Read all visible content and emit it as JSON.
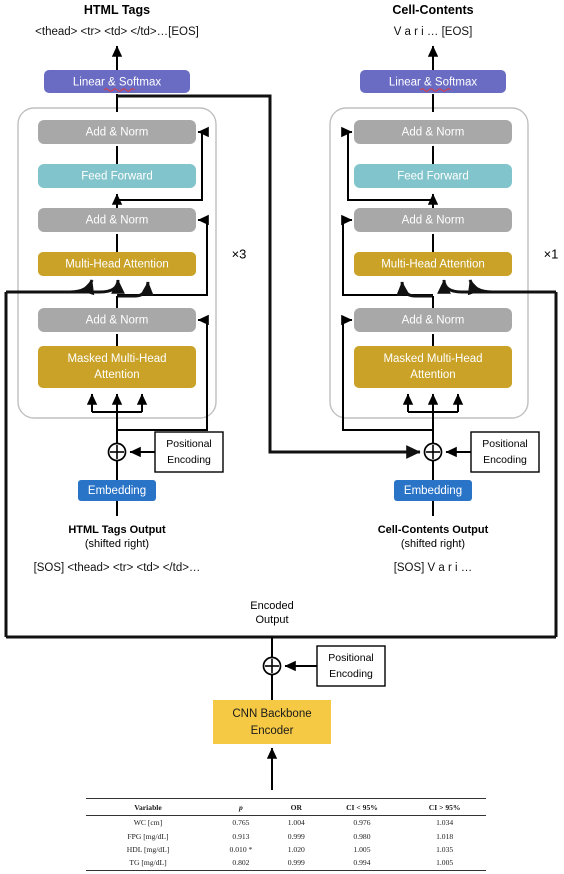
{
  "diagram": {
    "title": "Dual-decoder Transformer for table recognition",
    "colors": {
      "linear_softmax": "#6a6cc4",
      "add_norm": "#a8a8a8",
      "feed_forward": "#82c4cb",
      "attention": "#c9a227",
      "embedding": "#2a74c8",
      "cnn_backbone": "#f6c944",
      "panel_border": "#bfbfbf",
      "line": "#000000"
    },
    "branches": [
      {
        "id": "html-tags",
        "header_title": "HTML Tags",
        "header_sequence": "<thead> <tr> <td> </td>…[EOS]",
        "repeat_label": "×3",
        "footer_title": "HTML Tags Output",
        "footer_subtitle": "(shifted right)",
        "footer_sequence": "[SOS] <thead> <tr> <td> </td>…",
        "blocks": {
          "linear_softmax": "Linear & Softmax",
          "add_norm_top": "Add & Norm",
          "feed_forward": "Feed Forward",
          "add_norm_mid": "Add & Norm",
          "multi_head_attention": "Multi-Head Attention",
          "add_norm_bottom": "Add & Norm",
          "masked_attention_line1": "Masked Multi-Head",
          "masked_attention_line2": "Attention",
          "embedding": "Embedding",
          "positional_encoding_line1": "Positional",
          "positional_encoding_line2": "Encoding"
        }
      },
      {
        "id": "cell-contents",
        "header_title": "Cell-Contents",
        "header_sequence": "V a r i   … [EOS]",
        "repeat_label": "×1",
        "footer_title": "Cell-Contents Output",
        "footer_subtitle": "(shifted right)",
        "footer_sequence": "[SOS] V a r i   …",
        "blocks": {
          "linear_softmax": "Linear & Softmax",
          "add_norm_top": "Add & Norm",
          "feed_forward": "Feed Forward",
          "add_norm_mid": "Add & Norm",
          "multi_head_attention": "Multi-Head Attention",
          "add_norm_bottom": "Add & Norm",
          "masked_attention_line1": "Masked Multi-Head",
          "masked_attention_line2": "Attention",
          "embedding": "Embedding",
          "positional_encoding_line1": "Positional",
          "positional_encoding_line2": "Encoding"
        }
      }
    ],
    "encoder": {
      "bus_label_line1": "Encoded",
      "bus_label_line2": "Output",
      "positional_encoding_line1": "Positional",
      "positional_encoding_line2": "Encoding",
      "backbone_line1": "CNN Backbone",
      "backbone_line2": "Encoder"
    }
  },
  "results_table": {
    "columns": [
      "Variable",
      "p",
      "OR",
      "CI < 95%",
      "CI > 95%"
    ],
    "rows": [
      {
        "variable": "WC [cm]",
        "p": "0.765",
        "or": "1.004",
        "ci_low": "0.976",
        "ci_high": "1.034"
      },
      {
        "variable": "FPG [mg/dL]",
        "p": "0.913",
        "or": "0.999",
        "ci_low": "0.980",
        "ci_high": "1.018"
      },
      {
        "variable": "HDL [mg/dL]",
        "p": "0.010 *",
        "or": "1.020",
        "ci_low": "1.005",
        "ci_high": "1.035"
      },
      {
        "variable": "TG [mg/dL]",
        "p": "0.802",
        "or": "0.999",
        "ci_low": "0.994",
        "ci_high": "1.005"
      }
    ]
  }
}
